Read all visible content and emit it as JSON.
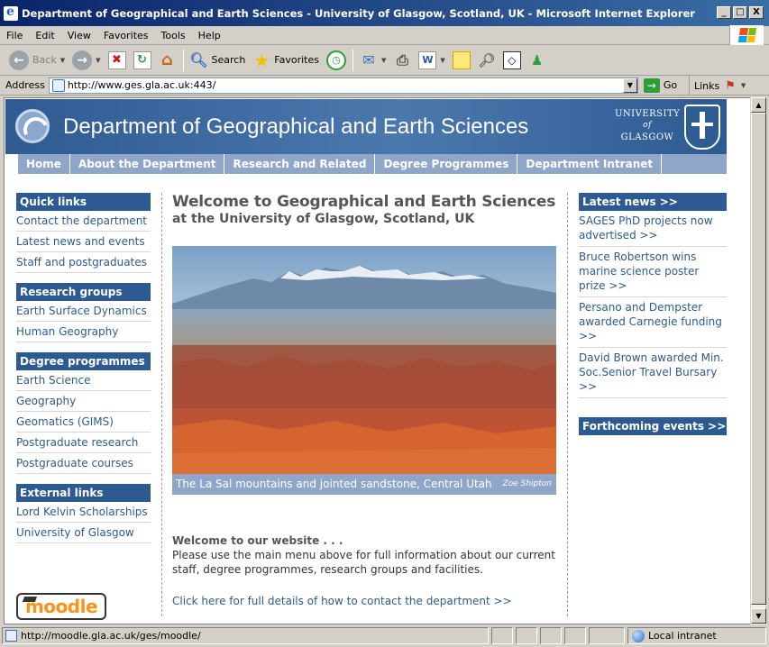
{
  "window": {
    "title": "Department of Geographical and Earth Sciences - University of Glasgow, Scotland, UK - Microsoft Internet Explorer",
    "min": "_",
    "max": "□",
    "close": "X"
  },
  "menu": [
    "File",
    "Edit",
    "View",
    "Favorites",
    "Tools",
    "Help"
  ],
  "toolbar": {
    "back": "Back",
    "search": "Search",
    "favorites": "Favorites"
  },
  "address": {
    "label": "Address",
    "url": "http://www.ges.gla.ac.uk:443/",
    "go": "Go",
    "links": "Links"
  },
  "site": {
    "title": "Department of Geographical and Earth Sciences",
    "university_line1": "UNIVERSITY",
    "university_of": "of",
    "university_line2": "GLASGOW",
    "nav": [
      "Home",
      "About the Department",
      "Research and Related",
      "Degree Programmes",
      "Department Intranet"
    ],
    "left": [
      {
        "head": "Quick links",
        "links": [
          "Contact the department",
          "Latest news and events",
          "Staff and postgraduates"
        ]
      },
      {
        "head": "Research groups",
        "links": [
          "Earth Surface Dynamics",
          "Human Geography"
        ]
      },
      {
        "head": "Degree programmes",
        "links": [
          "Earth Science",
          "Geography",
          "Geomatics (GIMS)",
          "Postgraduate research",
          "Postgraduate courses"
        ]
      },
      {
        "head": "External links",
        "links": [
          "Lord Kelvin Scholarships",
          "University of Glasgow"
        ]
      }
    ],
    "moodle": "moodle",
    "welcome_title": "Welcome to Geographical and Earth Sciences",
    "welcome_sub": "at the University of Glasgow, Scotland, UK",
    "caption": "The La Sal mountains and jointed sandstone, Central Utah",
    "credit": "Zoe Shipton",
    "welcome_heading": "Welcome to our website . . .",
    "welcome_text": "Please use the main menu above for full information about our current staff, degree programmes, research groups and facilities.",
    "contact_link": "Click here for full details of how to contact the department >>",
    "news_head": "Latest news >>",
    "news": [
      "SAGES PhD projects now advertised >>",
      "Bruce Robertson wins marine science poster prize >>",
      "Persano and Dempster awarded Carnegie funding >>",
      "David Brown awarded Min. Soc.Senior Travel Bursary >>"
    ],
    "events_head": "Forthcoming events >>"
  },
  "status": {
    "url": "http://moodle.gla.ac.uk/ges/moodle/",
    "zone": "Local intranet"
  }
}
